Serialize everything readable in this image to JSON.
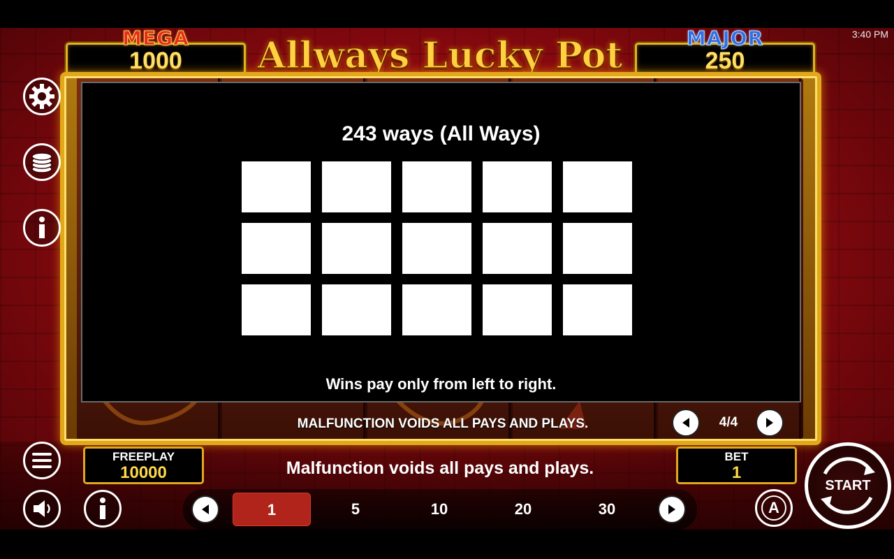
{
  "status_bar": {
    "time": "3:40 PM"
  },
  "jackpots": {
    "mega": {
      "label": "MEGA",
      "value": "1000"
    },
    "major": {
      "label": "MAJOR",
      "value": "250"
    }
  },
  "game_title": "Allways Lucky Pot",
  "info_dialog": {
    "title": "243 ways (All Ways)",
    "grid": {
      "columns": 5,
      "rows": 3
    },
    "note": "Wins pay only from left to right.",
    "pagination": {
      "label": "4/4"
    }
  },
  "frame_notice": "MALFUNCTION VOIDS ALL PAYS AND PLAYS.",
  "bottom_notice": "Malfunction voids all pays and plays.",
  "freeplay": {
    "label": "FREEPLAY",
    "value": "10000"
  },
  "bet": {
    "label": "BET",
    "value": "1"
  },
  "bet_options": [
    "1",
    "5",
    "10",
    "20",
    "30"
  ],
  "selected_bet": "1",
  "start_button": {
    "label": "START"
  },
  "auto_button": {
    "label": "A"
  },
  "side_icons": [
    "gear-icon",
    "coins-icon",
    "info-icon",
    "menu-icon",
    "sound-icon",
    "info-icon"
  ],
  "colors": {
    "gold": "#e2a81c",
    "jackpot_value": "#ffd84a",
    "selected_bet": "#b0241b",
    "mega": "#e82a1c",
    "major": "#2f6fe4"
  }
}
